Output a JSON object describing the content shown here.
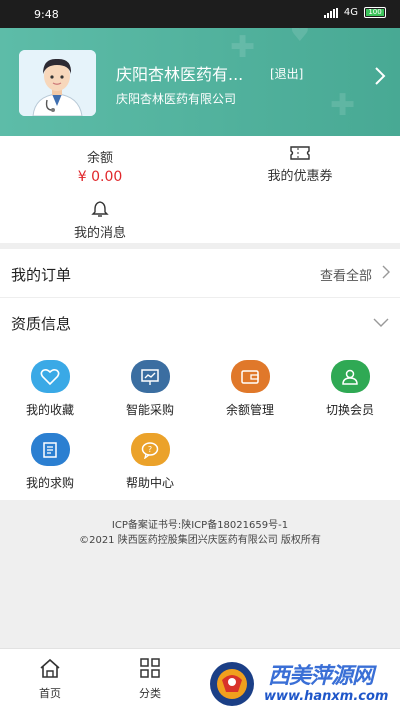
{
  "status": {
    "time": "9:48",
    "network": "4G",
    "battery": "100"
  },
  "header": {
    "company_name": "庆阳杏林医药有...",
    "logout_label": "[退出]",
    "company_full": "庆阳杏林医药有限公司"
  },
  "account": {
    "balance_label": "余额",
    "balance_value": "¥ 0.00",
    "coupon_label": "我的优惠券",
    "messages_label": "我的消息"
  },
  "orders": {
    "title": "我的订单",
    "view_all": "查看全部"
  },
  "qualification": {
    "title": "资质信息"
  },
  "grid": [
    {
      "label": "我的收藏",
      "icon": "heart-icon",
      "color": "#3aa9e6"
    },
    {
      "label": "智能采购",
      "icon": "chart-board-icon",
      "color": "#3b6ea1"
    },
    {
      "label": "余额管理",
      "icon": "wallet-icon",
      "color": "#e0782a"
    },
    {
      "label": "切换会员",
      "icon": "member-switch-icon",
      "color": "#2fa954"
    },
    {
      "label": "我的求购",
      "icon": "document-edit-icon",
      "color": "#2b7fd1"
    },
    {
      "label": "帮助中心",
      "icon": "help-chat-icon",
      "color": "#eba22a"
    }
  ],
  "footer": {
    "icp": "ICP备案证书号:陕ICP备18021659号-1",
    "copyright": "©2021 陕西医药控股集团兴庆医药有限公司 版权所有"
  },
  "tabs": [
    {
      "label": "首页",
      "icon": "home-icon"
    },
    {
      "label": "分类",
      "icon": "category-grid-icon"
    }
  ],
  "watermark": {
    "text": "西美萍源网",
    "url": "www.hanxm.com"
  },
  "colors": {
    "header": "#52b49f",
    "price": "#e0272b"
  }
}
